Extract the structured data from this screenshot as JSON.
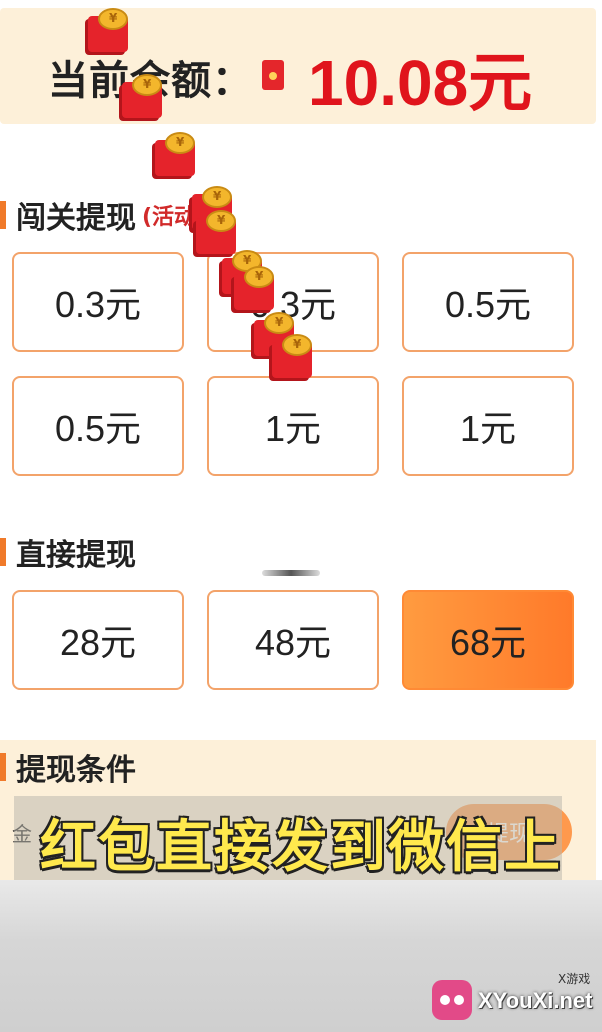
{
  "balance": {
    "label": "当前余额：",
    "value": "10.08元"
  },
  "level_withdraw": {
    "title": "闯关提现",
    "note": "(活动",
    "options": [
      "0.3元",
      "0.3元",
      "0.5元",
      "0.5元",
      "1元",
      "1元"
    ]
  },
  "direct_withdraw": {
    "title": "直接提现",
    "options": [
      "28元",
      "48元",
      "68元"
    ],
    "selected_index": 2
  },
  "conditions": {
    "title": "提现条件",
    "row_text": "金",
    "button_label": "提现"
  },
  "subtitle": "红包直接发到微信上",
  "watermark": {
    "small": "X游戏",
    "text": "XYouXi.net"
  },
  "colors": {
    "accent": "#f07a2a",
    "balance_value": "#e0141c",
    "selected_option": "#ff8a35",
    "subtitle": "#ffe94d"
  }
}
